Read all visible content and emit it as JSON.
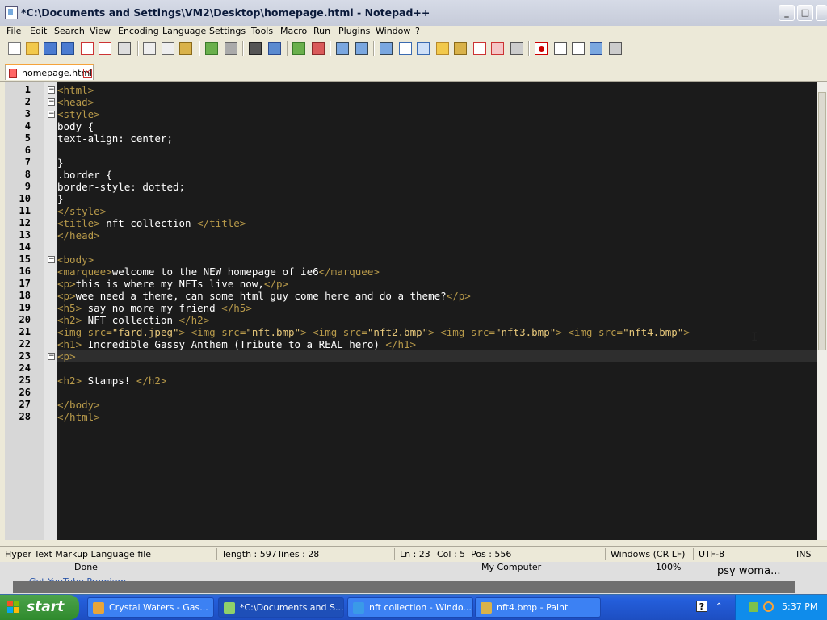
{
  "window": {
    "title": "*C:\\Documents and Settings\\VM2\\Desktop\\homepage.html - Notepad++"
  },
  "menu": [
    "File",
    "Edit",
    "Search",
    "View",
    "Encoding",
    "Language",
    "Settings",
    "Tools",
    "Macro",
    "Run",
    "Plugins",
    "Window",
    "?"
  ],
  "tab": {
    "label": "homepage.html"
  },
  "editor": {
    "lines": [
      "<html>",
      "<head>",
      "<style>",
      "body {",
      "text-align: center;",
      "",
      "}",
      ".border {",
      "border-style: dotted;",
      "}",
      "</style>",
      "<title> nft collection </title>",
      "</head>",
      "",
      "<body>",
      "<marquee>welcome to the NEW homepage of ie6</marquee>",
      "<p>this is where my NFTs live now,</p>",
      "<p>wee need a theme, can some html guy come here and do a theme?</p>",
      "<h5> say no more my friend </h5>",
      "<h2> NFT collection </h2>",
      "<img src=\"fard.jpeg\"> <img src=\"nft.bmp\"> <img src=\"nft2.bmp\"> <img src=\"nft3.bmp\"> <img src=\"nft4.bmp\">",
      "<h1> Incredible Gassy Anthem (Tribute to a REAL hero) </h1>",
      "<p> ",
      "",
      "<h2> Stamps! </h2>",
      "",
      "</body>",
      "</html>"
    ],
    "fold_lines": [
      1,
      2,
      3,
      15,
      23
    ],
    "current_line": 23,
    "colors": {
      "tag": "#b89a4a",
      "text": "#ffffff",
      "attr_value": "#e6c77a",
      "background": "#1b1b1b"
    }
  },
  "status": {
    "file_type": "Hyper Text Markup Language file",
    "length": "length : 597",
    "lines": "lines : 28",
    "ln": "Ln : 23",
    "col": "Col : 5",
    "pos": "Pos : 556",
    "eol": "Windows (CR LF)",
    "encoding": "UTF-8",
    "mode": "INS"
  },
  "background_window": {
    "done": "Done",
    "computer": "My Computer",
    "zoom": "100%",
    "partial": "Get YouTube Premium",
    "right_text": "psy woma..."
  },
  "taskbar": {
    "start": "start",
    "tasks": [
      {
        "label": "Crystal Waters - Gas...",
        "icon": "media-player-icon",
        "color": "#e8a53a"
      },
      {
        "label": "*C:\\Documents and S...",
        "icon": "notepadpp-icon",
        "color": "#8fd16a",
        "active": true
      },
      {
        "label": "nft collection - Windo...",
        "icon": "ie-icon",
        "color": "#3a9ae8"
      },
      {
        "label": "nft4.bmp - Paint",
        "icon": "paint-icon",
        "color": "#d9b24a"
      }
    ],
    "clock": "5:37 PM"
  }
}
